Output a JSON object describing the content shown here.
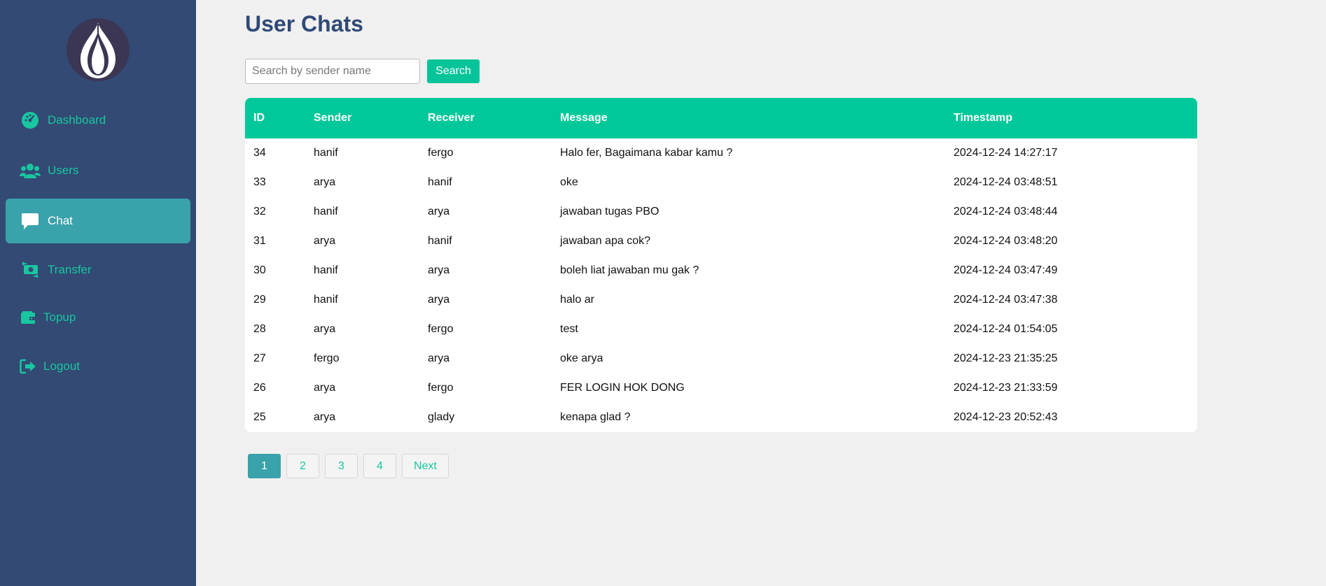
{
  "sidebar": {
    "items": [
      {
        "label": "Dashboard",
        "icon": "dashboard-icon"
      },
      {
        "label": "Users",
        "icon": "users-icon"
      },
      {
        "label": "Chat",
        "icon": "chat-icon",
        "active": true
      },
      {
        "label": "Transfer",
        "icon": "transfer-icon"
      },
      {
        "label": "Topup",
        "icon": "wallet-icon"
      },
      {
        "label": "Logout",
        "icon": "logout-icon"
      }
    ]
  },
  "main": {
    "title": "User Chats",
    "search": {
      "placeholder": "Search by sender name",
      "value": "",
      "button_label": "Search"
    },
    "table": {
      "headers": [
        "ID",
        "Sender",
        "Receiver",
        "Message",
        "Timestamp"
      ],
      "rows": [
        [
          "34",
          "hanif",
          "fergo",
          "Halo fer, Bagaimana kabar kamu ?",
          "2024-12-24 14:27:17"
        ],
        [
          "33",
          "arya",
          "hanif",
          "oke",
          "2024-12-24 03:48:51"
        ],
        [
          "32",
          "hanif",
          "arya",
          "jawaban tugas PBO",
          "2024-12-24 03:48:44"
        ],
        [
          "31",
          "arya",
          "hanif",
          "jawaban apa cok?",
          "2024-12-24 03:48:20"
        ],
        [
          "30",
          "hanif",
          "arya",
          "boleh liat jawaban mu gak ?",
          "2024-12-24 03:47:49"
        ],
        [
          "29",
          "hanif",
          "arya",
          "halo ar",
          "2024-12-24 03:47:38"
        ],
        [
          "28",
          "arya",
          "fergo",
          "test",
          "2024-12-24 01:54:05"
        ],
        [
          "27",
          "fergo",
          "arya",
          "oke arya",
          "2024-12-23 21:35:25"
        ],
        [
          "26",
          "arya",
          "fergo",
          "FER LOGIN HOK DONG",
          "2024-12-23 21:33:59"
        ],
        [
          "25",
          "arya",
          "glady",
          "kenapa glad ?",
          "2024-12-23 20:52:43"
        ]
      ]
    },
    "pagination": {
      "pages": [
        "1",
        "2",
        "3",
        "4"
      ],
      "current": "1",
      "next_label": "Next"
    }
  },
  "colors": {
    "sidebar_bg": "#324a74",
    "accent": "#00c89a",
    "active_nav": "#3aa2aa",
    "title": "#2f4a77",
    "page_bg": "#f0f0f0"
  }
}
